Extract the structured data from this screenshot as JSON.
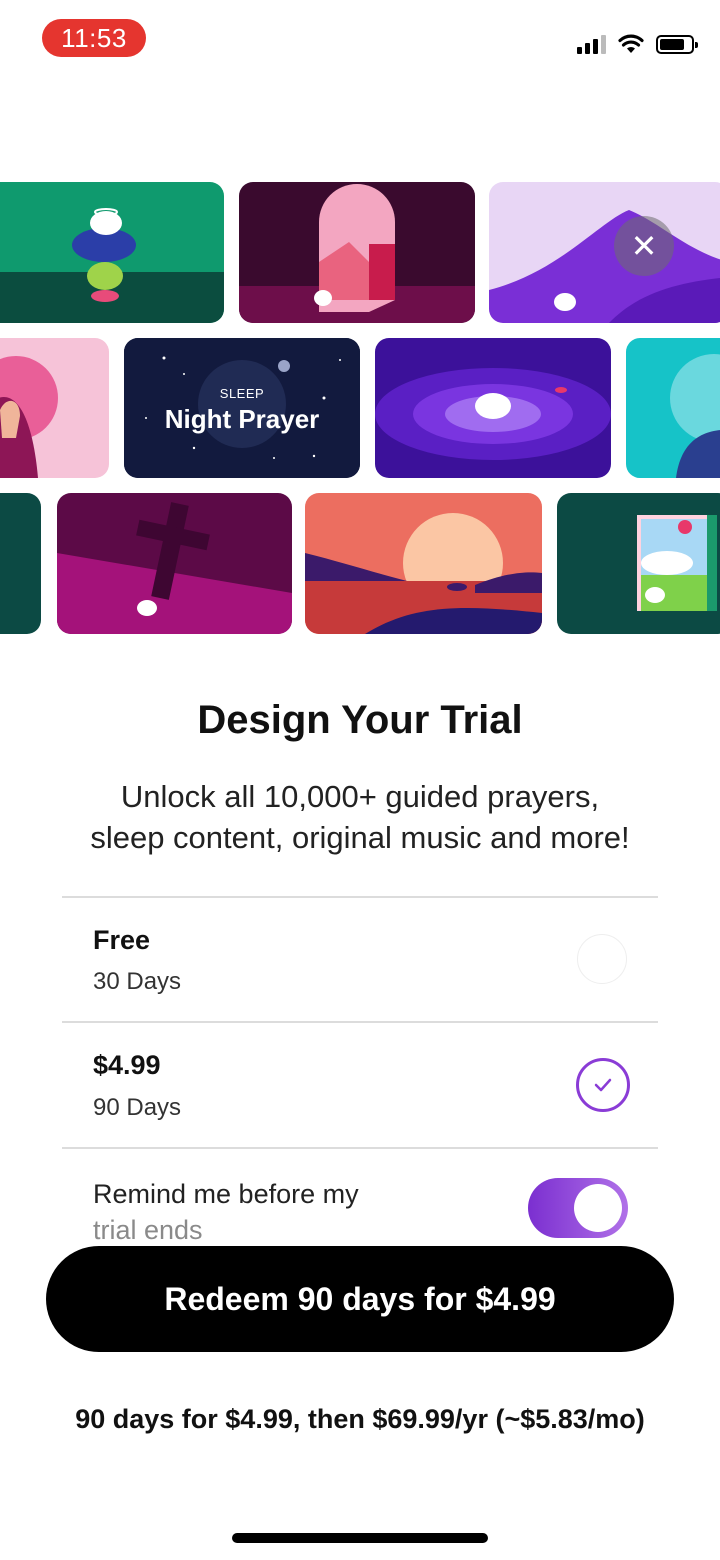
{
  "status_bar": {
    "time": "11:53"
  },
  "hero": {
    "close_icon_glyph": "✕",
    "night_tile": {
      "eyebrow": "SLEEP",
      "title": "Night Prayer"
    }
  },
  "title": "Design Your Trial",
  "subtitle_lines": [
    "Unlock all 10,000+ guided prayers,",
    "sleep content, original music and more!"
  ],
  "options": [
    {
      "title": "Free",
      "duration": "30 Days",
      "selected": false
    },
    {
      "title": "$4.99",
      "duration": "90 Days",
      "selected": true
    }
  ],
  "reminder": {
    "line1": "Remind me before my",
    "line2": "trial ends",
    "enabled": true
  },
  "cta": {
    "label": "Redeem 90 days for $4.99"
  },
  "price_note": "90 days for $4.99, then $69.99/yr (~$5.83/mo)",
  "colors": {
    "accent": "#8a3cd6",
    "time_pill": "#e5352f",
    "cta": "#000000"
  }
}
